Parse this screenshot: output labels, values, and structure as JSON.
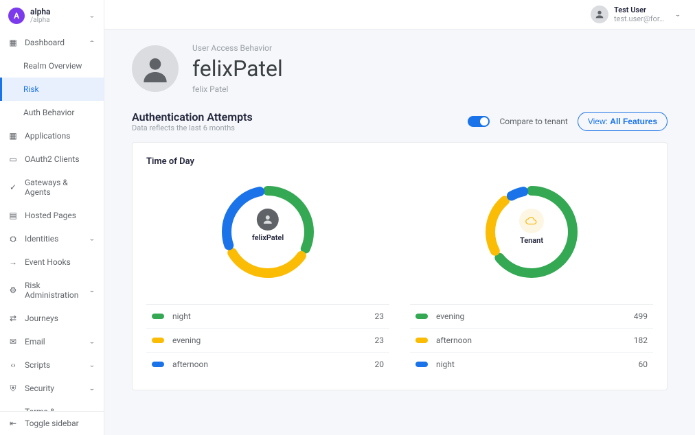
{
  "realm": {
    "initial": "A",
    "name": "alpha",
    "path": "/alpha"
  },
  "currentUser": {
    "name": "Test User",
    "email": "test.user@for…"
  },
  "sidebar": {
    "dashboard": {
      "label": "Dashboard"
    },
    "dashboardSub": [
      {
        "label": "Realm Overview"
      },
      {
        "label": "Risk"
      },
      {
        "label": "Auth Behavior"
      }
    ],
    "items": [
      {
        "label": "Applications",
        "icon": "grid",
        "chev": false
      },
      {
        "label": "OAuth2 Clients",
        "icon": "box",
        "chev": false
      },
      {
        "label": "Gateways & Agents",
        "icon": "shield-check",
        "chev": false
      },
      {
        "label": "Hosted Pages",
        "icon": "page",
        "chev": false
      },
      {
        "label": "Identities",
        "icon": "people",
        "chev": true
      },
      {
        "label": "Event Hooks",
        "icon": "exit",
        "chev": false
      },
      {
        "label": "Risk Administration",
        "icon": "gear",
        "chev": true
      },
      {
        "label": "Journeys",
        "icon": "route",
        "chev": false
      },
      {
        "label": "Email",
        "icon": "mail",
        "chev": true
      },
      {
        "label": "Scripts",
        "icon": "code",
        "chev": true
      },
      {
        "label": "Security",
        "icon": "shield",
        "chev": true
      },
      {
        "label": "Terms & Conditions",
        "icon": "terms",
        "chev": false
      }
    ],
    "toggle": "Toggle sidebar"
  },
  "page": {
    "overline": "User Access Behavior",
    "title": "felixPatel",
    "sub": "felix Patel"
  },
  "section": {
    "title": "Authentication Attempts",
    "sub": "Data reflects the last 6 months",
    "compare_label": "Compare to tenant",
    "view_btn_prefix": "View: ",
    "view_btn_value": "All Features"
  },
  "card": {
    "title": "Time of Day"
  },
  "chart_data": [
    {
      "type": "pie",
      "center_label": "felixPatel",
      "series": [
        {
          "name": "night",
          "value": 23,
          "color": "#34a853"
        },
        {
          "name": "evening",
          "value": 23,
          "color": "#fbbc05"
        },
        {
          "name": "afternoon",
          "value": 20,
          "color": "#1a73e8"
        }
      ]
    },
    {
      "type": "pie",
      "center_label": "Tenant",
      "series": [
        {
          "name": "evening",
          "value": 499,
          "color": "#34a853"
        },
        {
          "name": "afternoon",
          "value": 182,
          "color": "#fbbc05"
        },
        {
          "name": "night",
          "value": 60,
          "color": "#1a73e8"
        }
      ]
    }
  ]
}
